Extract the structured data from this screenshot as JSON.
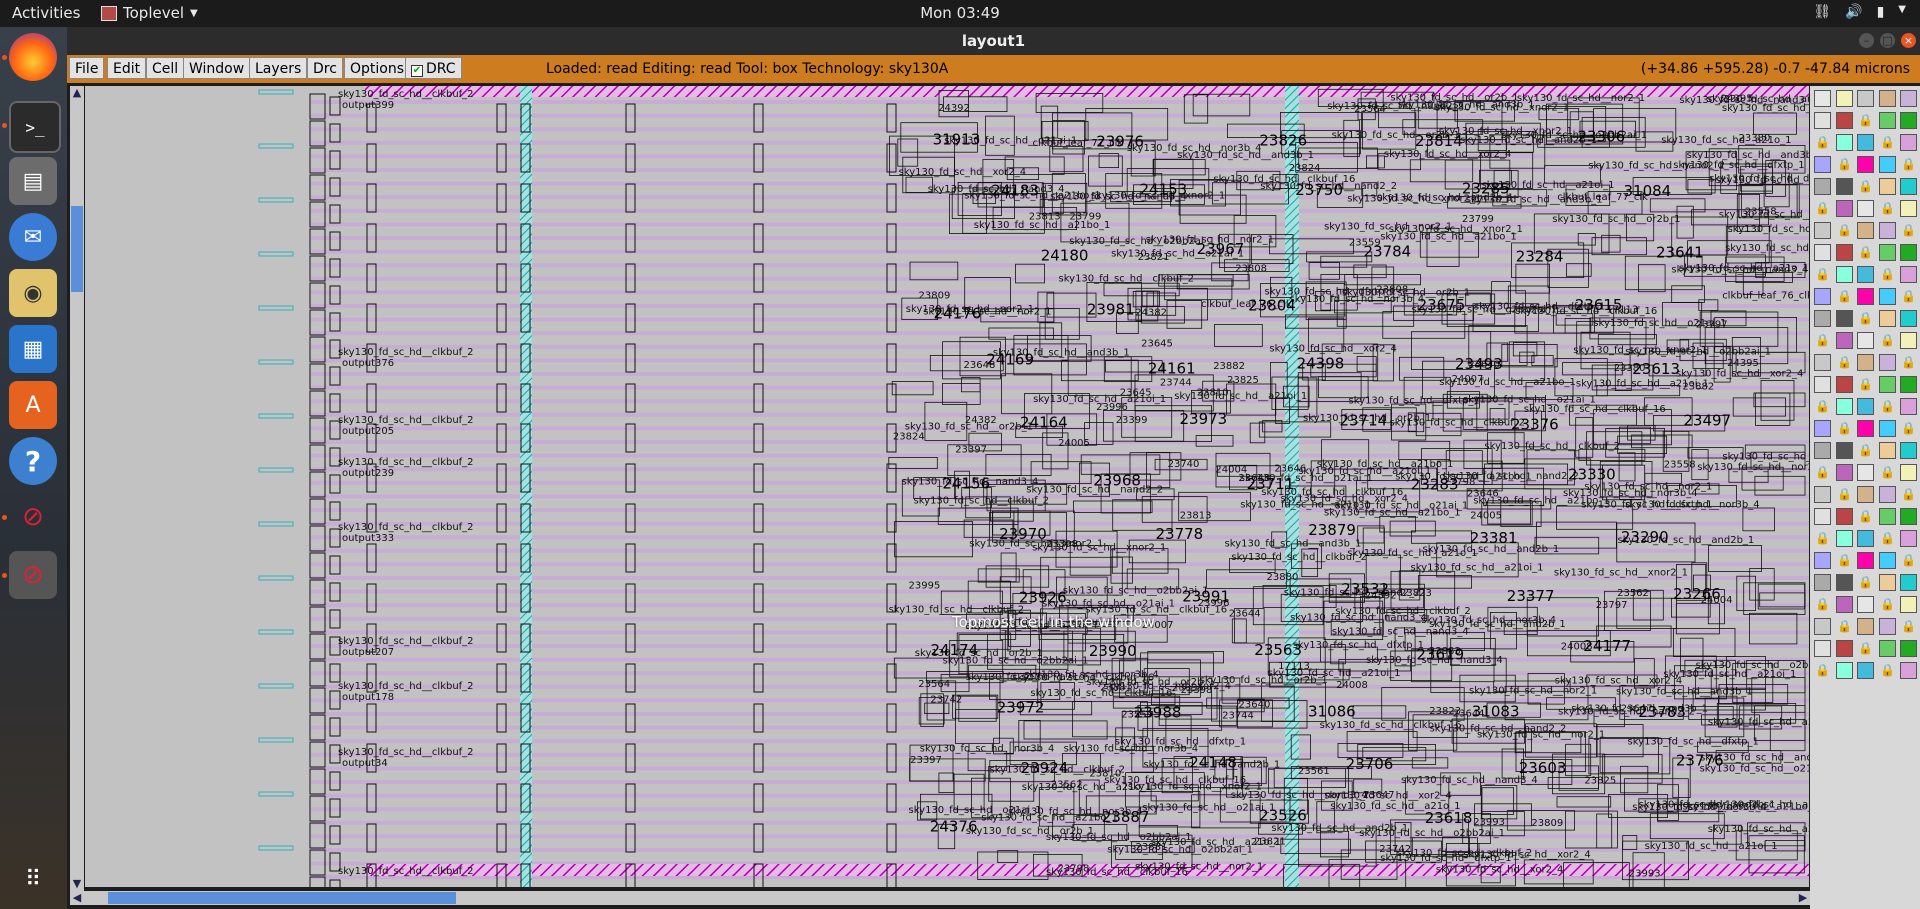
{
  "topbar": {
    "activities": "Activities",
    "app_name": "Toplevel",
    "clock": "Mon 03:49"
  },
  "window": {
    "title": "layout1"
  },
  "menu": {
    "items": [
      "File",
      "Edit",
      "Cell",
      "Window",
      "Layers",
      "Drc",
      "Options"
    ],
    "drc_toggle": "DRC",
    "status": "Loaded: read Editing: read Tool: box  Technology: sky130A",
    "coordinates": "(+34.86 +595.28) -0.7 -47.84 microns"
  },
  "canvas": {
    "overlay_label": "Topmost cell in the window",
    "inst_number_cells": [
      "31913",
      "24183",
      "24180",
      "24176",
      "24169",
      "24164",
      "24156",
      "23970",
      "23926",
      "24174",
      "23972",
      "23924",
      "24376",
      "23976",
      "24153",
      "23967",
      "23981",
      "24161",
      "23973",
      "23968",
      "23778",
      "23991",
      "23990",
      "23988",
      "24148",
      "23887",
      "23826",
      "23750",
      "23784",
      "23804",
      "24398",
      "23714",
      "23711",
      "23879",
      "23532",
      "23563",
      "31086",
      "23706",
      "23526",
      "23814",
      "23285",
      "23284",
      "23675",
      "23493",
      "23376",
      "23283",
      "23381",
      "23377",
      "23619",
      "31083",
      "23603",
      "23618",
      "23306",
      "31084",
      "23641",
      "23615",
      "23613",
      "23497",
      "23330",
      "23290",
      "23266",
      "24177",
      "23783",
      "23776"
    ],
    "cell_names": [
      "sky130_fd_sc_hd__clkbuf_2",
      "sky130_fd_sc_hd__clkbuf_16",
      "sky130_fd_sc_hd__nand3_4",
      "sky130_fd_sc_hd__dfxtp_1",
      "sky130_fd_sc_hd__a21oi_1",
      "sky130_fd_sc_hd__o21ai_1",
      "sky130_fd_sc_hd__nor2_1",
      "sky130_fd_sc_hd__xnor2_1",
      "sky130_fd_sc_hd__and3b_1",
      "sky130_fd_sc_hd__nand2_2",
      "sky130_fd_sc_hd__xor2_4",
      "sky130_fd_sc_hd__a21o_1",
      "sky130_fd_sc_hd__o2bb2ai_1",
      "sky130_fd_sc_hd__nor3b_4",
      "sky130_fd_sc_hd__or2b_1",
      "sky130_fd_sc_hd__a21bo_1",
      "sky130_fd_sc_hd__and2b_1"
    ],
    "output_labels": [
      "output399",
      "output376",
      "output205",
      "output239",
      "output333",
      "output207",
      "output178",
      "output34"
    ],
    "sample_inst_labels": [
      "clkbuf_leaf_76_clk",
      "clkbuf_leaf_77_clk",
      "17113",
      "24382",
      "24392",
      "24395",
      "23825",
      "23993",
      "23995",
      "23996",
      "23808",
      "23809",
      "23810",
      "23813",
      "23821",
      "24004",
      "24005",
      "24007",
      "24008",
      "23823",
      "23824",
      "23646",
      "23648",
      "23644",
      "23640",
      "23645",
      "23647",
      "23380",
      "23797",
      "23798",
      "23799",
      "23880",
      "23881",
      "23882",
      "23883",
      "23742",
      "23744",
      "23740",
      "23397",
      "23398",
      "23399",
      "23558",
      "23559",
      "23561",
      "23562",
      "23564"
    ]
  },
  "colors": {
    "menubar": "#cd7d1f",
    "canvas_bg": "#c2c2c2",
    "rail_magenta": "#c000c0",
    "track_purple": "#c8a6d8",
    "via_cyan": "#20c0c0",
    "scroll_thumb": "#5b8fd9"
  },
  "dock": {
    "icons": [
      "firefox-icon",
      "terminal-icon",
      "files-icon",
      "thunderbird-icon",
      "rhythmbox-icon",
      "writer-icon",
      "software-icon",
      "help-icon",
      "blocked-app-icon",
      "blocked-app-icon",
      "app-grid-icon"
    ]
  }
}
